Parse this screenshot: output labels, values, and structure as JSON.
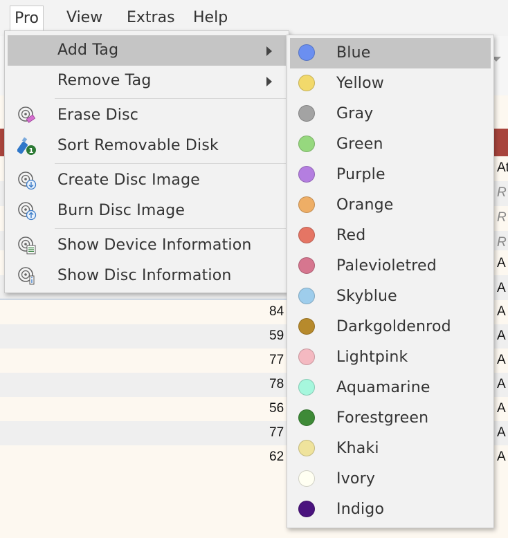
{
  "menubar": {
    "items": [
      {
        "label": "Pro",
        "active": true
      },
      {
        "label": "View"
      },
      {
        "label": "Extras"
      },
      {
        "label": "Help"
      }
    ]
  },
  "menu": {
    "items": [
      {
        "label": "Add Tag",
        "icon": "none",
        "has_submenu": true,
        "highlighted": true
      },
      {
        "label": "Remove Tag",
        "icon": "none",
        "has_submenu": true
      },
      {
        "label": "Erase Disc",
        "icon": "disc-eraser-icon"
      },
      {
        "label": "Sort Removable Disk",
        "icon": "usb-drive-badge-icon"
      },
      {
        "label": "Create Disc Image",
        "icon": "disc-download-icon"
      },
      {
        "label": "Burn Disc Image",
        "icon": "disc-upload-icon"
      },
      {
        "label": "Show Device Information",
        "icon": "disc-list-icon"
      },
      {
        "label": "Show Disc Information",
        "icon": "disc-info-icon"
      }
    ]
  },
  "tag_submenu": {
    "items": [
      {
        "label": "Blue",
        "color": "#6b8ff0",
        "highlighted": true
      },
      {
        "label": "Yellow",
        "color": "#f2d96b"
      },
      {
        "label": "Gray",
        "color": "#a3a3a3"
      },
      {
        "label": "Green",
        "color": "#96d87e"
      },
      {
        "label": "Purple",
        "color": "#b47ee0"
      },
      {
        "label": "Orange",
        "color": "#eeae66"
      },
      {
        "label": "Red",
        "color": "#e57564"
      },
      {
        "label": "Palevioletred",
        "color": "#d6768f"
      },
      {
        "label": "Skyblue",
        "color": "#9ecdec"
      },
      {
        "label": "Darkgoldenrod",
        "color": "#b78a2c"
      },
      {
        "label": "Lightpink",
        "color": "#f4b9c1"
      },
      {
        "label": "Aquamarine",
        "color": "#a6f7dd"
      },
      {
        "label": "Forestgreen",
        "color": "#3e8a37"
      },
      {
        "label": "Khaki",
        "color": "#efe39c"
      },
      {
        "label": "Ivory",
        "color": "#fffff2"
      },
      {
        "label": "Indigo",
        "color": "#4a137e"
      }
    ]
  },
  "background": {
    "row_numbers": [
      "84",
      "59",
      "77",
      "78",
      "56",
      "77",
      "62"
    ],
    "right_column": [
      "At",
      "R",
      "R",
      "R",
      "A",
      "A",
      "A",
      "A",
      "A",
      "A",
      "A",
      "A",
      "A"
    ],
    "accent_color": "#a8443c"
  }
}
